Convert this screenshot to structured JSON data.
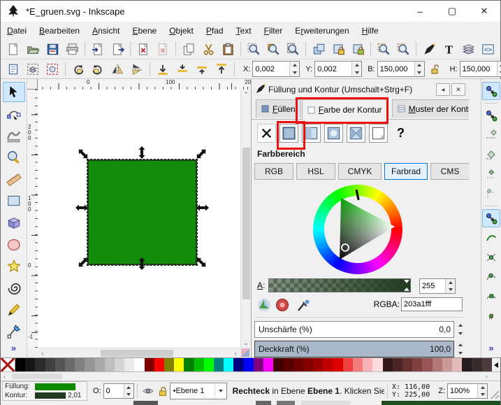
{
  "window": {
    "title": "*E_gruen.svg - Inkscape",
    "minimize": "–",
    "maximize": "▢",
    "close": "✕"
  },
  "menu": {
    "items": [
      {
        "pre": "",
        "key": "D",
        "rest": "atei"
      },
      {
        "pre": "",
        "key": "B",
        "rest": "earbeiten"
      },
      {
        "pre": "",
        "key": "A",
        "rest": "nsicht"
      },
      {
        "pre": "",
        "key": "E",
        "rest": "bene"
      },
      {
        "pre": "",
        "key": "O",
        "rest": "bjekt"
      },
      {
        "pre": "",
        "key": "P",
        "rest": "fad"
      },
      {
        "pre": "",
        "key": "T",
        "rest": "ext"
      },
      {
        "pre": "",
        "key": "F",
        "rest": "ilter"
      },
      {
        "pre": "E",
        "key": "r",
        "rest": "weiterungen"
      },
      {
        "pre": "",
        "key": "H",
        "rest": "ilfe"
      }
    ]
  },
  "toolbar_main": {
    "icons": [
      "new-document",
      "open-folder",
      "save",
      "print",
      "sep",
      "import",
      "export",
      "sep",
      "undo",
      "redo",
      "sep",
      "copy",
      "cut",
      "paste",
      "sep",
      "zoom-selection",
      "zoom-drawing",
      "zoom-page",
      "sep",
      "duplicate",
      "clone",
      "unlink-clone",
      "sep",
      "find",
      "find-replace",
      "sep",
      "fill-stroke-dialog",
      "text-dialog",
      "layers-dialog",
      "xml-editor"
    ],
    "overflow": "»"
  },
  "toolbar_tool": {
    "icons": [
      "select-all",
      "select-all-layers",
      "deselect",
      "sep",
      "rotate-ccw",
      "rotate-cw",
      "flip-horizontal",
      "flip-vertical",
      "sep",
      "lower-to-bottom",
      "lower",
      "raise",
      "raise-to-top",
      "sep"
    ],
    "fields": [
      {
        "id": "x",
        "label": "X:",
        "value": "0,002"
      },
      {
        "id": "y",
        "label": "Y:",
        "value": "0,002"
      },
      {
        "id": "b",
        "label": "B:",
        "value": "150,000"
      },
      {
        "id": "h",
        "label": "H:",
        "value": "150,000"
      }
    ],
    "lock_icon": "lock-open",
    "overflow": "»"
  },
  "toolbox": {
    "tools": [
      {
        "name": "selector-tool",
        "active": true
      },
      {
        "name": "node-tool",
        "active": false
      },
      {
        "name": "tweak-tool",
        "active": false
      },
      {
        "name": "zoom-tool",
        "active": false
      },
      {
        "name": "measure-tool",
        "active": false
      },
      {
        "name": "rectangle-tool",
        "active": false
      },
      {
        "name": "box3d-tool",
        "active": false
      },
      {
        "name": "ellipse-tool",
        "active": false
      },
      {
        "name": "star-tool",
        "active": false
      },
      {
        "name": "spiral-tool",
        "active": false
      },
      {
        "name": "pencil-tool",
        "active": false
      },
      {
        "name": "calligraphy-tool",
        "active": false
      }
    ],
    "overflow": "»"
  },
  "canvas": {
    "square": {
      "fill": "#128a0a",
      "stroke": "#203a1f"
    },
    "hruler_labels": [
      {
        "text": "0",
        "off": 70
      },
      {
        "text": "100",
        "off": 183
      },
      {
        "text": "20",
        "off": 296
      }
    ],
    "vruler_labels": [
      {
        "text": "200",
        "off": 50
      },
      {
        "text": "100",
        "off": 152
      },
      {
        "text": "0",
        "off": 248
      },
      {
        "text": "-1",
        "off": 350
      }
    ]
  },
  "palette": {
    "colors": [
      "#000000",
      "#161616",
      "#2b2b2b",
      "#404040",
      "#555555",
      "#6b6b6b",
      "#808080",
      "#959595",
      "#aaaaaa",
      "#bfbfbf",
      "#d5d5d5",
      "#eaeaea",
      "#ffffff",
      "#800000",
      "#ff0000",
      "#808000",
      "#ffff00",
      "#008000",
      "#00c000",
      "#00ff00",
      "#008080",
      "#00ffff",
      "#000080",
      "#0000ff",
      "#800080",
      "#ff00ff",
      "#400000",
      "#570000",
      "#6e0000",
      "#850000",
      "#9c0000",
      "#c00000",
      "#e00000",
      "#f04040",
      "#f47c7c",
      "#f8b4b4",
      "#fcdcdc",
      "#331a1a",
      "#4d2626",
      "#663333",
      "#804040",
      "#995555",
      "#b37777",
      "#cc9999",
      "#e6bbbb",
      "#241c1c",
      "#382c2c",
      "#4c3c3c"
    ]
  },
  "dialog": {
    "title": "Füllung und Kontur (Umschalt+Strg+F)",
    "collapse": "◂",
    "close": "✕",
    "tabs": [
      {
        "key": "F",
        "rest": "üllen",
        "active": false,
        "icon": "fill-tab-icon"
      },
      {
        "key": "F",
        "rest": "arbe der Kontur",
        "active": true,
        "icon": "stroke-paint-tab-icon"
      },
      {
        "key": "M",
        "rest": "uster der Kontur",
        "active": false,
        "icon": "stroke-style-tab-icon"
      }
    ],
    "modes": [
      "no-paint",
      "flat-color",
      "linear-gradient",
      "radial-gradient",
      "pattern",
      "swatch",
      "unknown"
    ],
    "unknown_glyph": "?",
    "section_label": "Farbbereich",
    "colorspaces": [
      {
        "label": "RGB",
        "active": false
      },
      {
        "label": "HSL",
        "active": false
      },
      {
        "label": "CMYK",
        "active": false
      },
      {
        "label": "Farbrad",
        "active": true
      },
      {
        "label": "CMS",
        "active": false
      }
    ],
    "alpha": {
      "key": "A",
      "rest": ":",
      "value": "255"
    },
    "rgba": {
      "label": "RGBA:",
      "value": "203a1fff"
    },
    "blur": {
      "label": "Unschärfe (%)",
      "value": "0,0"
    },
    "opacity": {
      "label": "Deckkraft (%)",
      "value": "100,0",
      "fill": "#a9b9c9"
    }
  },
  "snapbar": {
    "icons": [
      {
        "name": "snap-toggle",
        "active": true
      },
      {
        "name": "sep"
      },
      {
        "name": "snap-bounding-box",
        "active": false
      },
      {
        "name": "snap-bbox-edges",
        "active": false
      },
      {
        "name": "snap-bbox-corners",
        "active": false
      },
      {
        "name": "snap-bbox-edge-midpoints",
        "active": false
      },
      {
        "name": "snap-bbox-centers",
        "active": false
      },
      {
        "name": "sep"
      },
      {
        "name": "snap-nodes",
        "active": true
      },
      {
        "name": "snap-paths",
        "active": false
      },
      {
        "name": "snap-path-intersections",
        "active": false
      },
      {
        "name": "snap-cusp-nodes",
        "active": false
      },
      {
        "name": "snap-smooth-nodes",
        "active": false
      },
      {
        "name": "snap-midpoints",
        "active": false
      }
    ],
    "overflow": "»"
  },
  "statusbar": {
    "fill_label": "Füllung:",
    "stroke_label": "Kontur:",
    "stroke_width": "2,01",
    "fill_color": "#108a00",
    "stroke_color": "#203a1f",
    "opacity_label": "O:",
    "opacity_value": "0",
    "layer_prefix": "•",
    "layer": "Ebene 1",
    "msg_bold1": "Rechteck",
    "msg_mid": " in Ebene ",
    "msg_bold2": "Ebene 1",
    "msg_tail": ". Klicken Sie auf di",
    "x_label": "X:",
    "x_value": "116,00",
    "y_label": "Y:",
    "y_value": "225,00",
    "zoom_label": "Z:",
    "zoom_value": "100%"
  }
}
